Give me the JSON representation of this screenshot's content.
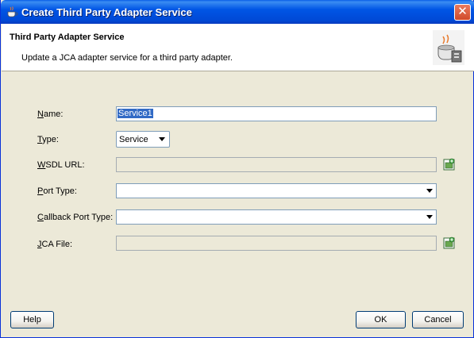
{
  "window": {
    "title": "Create Third Party Adapter Service"
  },
  "header": {
    "title": "Third Party Adapter Service",
    "description": "Update a JCA adapter service for a third party adapter."
  },
  "form": {
    "name_label": "ame:",
    "name_label_mnemonic": "N",
    "name_value": "Service1",
    "type_label": "ype:",
    "type_label_mnemonic": "T",
    "type_value": "Service",
    "wsdl_label": "SDL URL:",
    "wsdl_label_mnemonic": "W",
    "wsdl_value": "",
    "port_type_label": "ort Type:",
    "port_type_label_mnemonic": "P",
    "port_type_value": "",
    "callback_label": "allback Port Type:",
    "callback_label_mnemonic": "C",
    "callback_value": "",
    "jca_label": "CA File:",
    "jca_label_mnemonic": "J",
    "jca_value": ""
  },
  "buttons": {
    "help": "Help",
    "ok": "OK",
    "cancel": "Cancel"
  },
  "colors": {
    "titlebar": "#0055e5",
    "dialog_bg": "#ece9d8",
    "selection": "#316ac5",
    "close": "#d14a2a"
  },
  "icons": {
    "title": "coffee-cup-icon",
    "header": "adapter-wizard-icon",
    "wsdl_browse": "browse-icon",
    "jca_browse": "browse-icon"
  }
}
